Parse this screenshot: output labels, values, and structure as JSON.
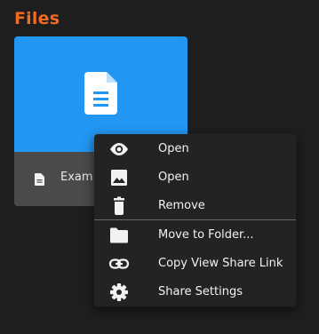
{
  "section": {
    "title": "Files"
  },
  "file_card": {
    "name": "Exam",
    "thumbnail_icon": "document-icon",
    "type_icon": "document-icon",
    "thumb_color": "#2196f3"
  },
  "context_menu": {
    "items": [
      {
        "label": "Open",
        "icon": "eye-icon"
      },
      {
        "label": "Open",
        "icon": "image-icon"
      },
      {
        "label": "Remove",
        "icon": "trash-icon"
      },
      {
        "label": "Move to Folder...",
        "icon": "folder-icon"
      },
      {
        "label": "Copy View Share Link",
        "icon": "link-icon"
      },
      {
        "label": "Share Settings",
        "icon": "gear-icon"
      }
    ]
  },
  "colors": {
    "accent": "#f26b21",
    "background": "#1e1e1e",
    "menu_background": "#232323"
  }
}
